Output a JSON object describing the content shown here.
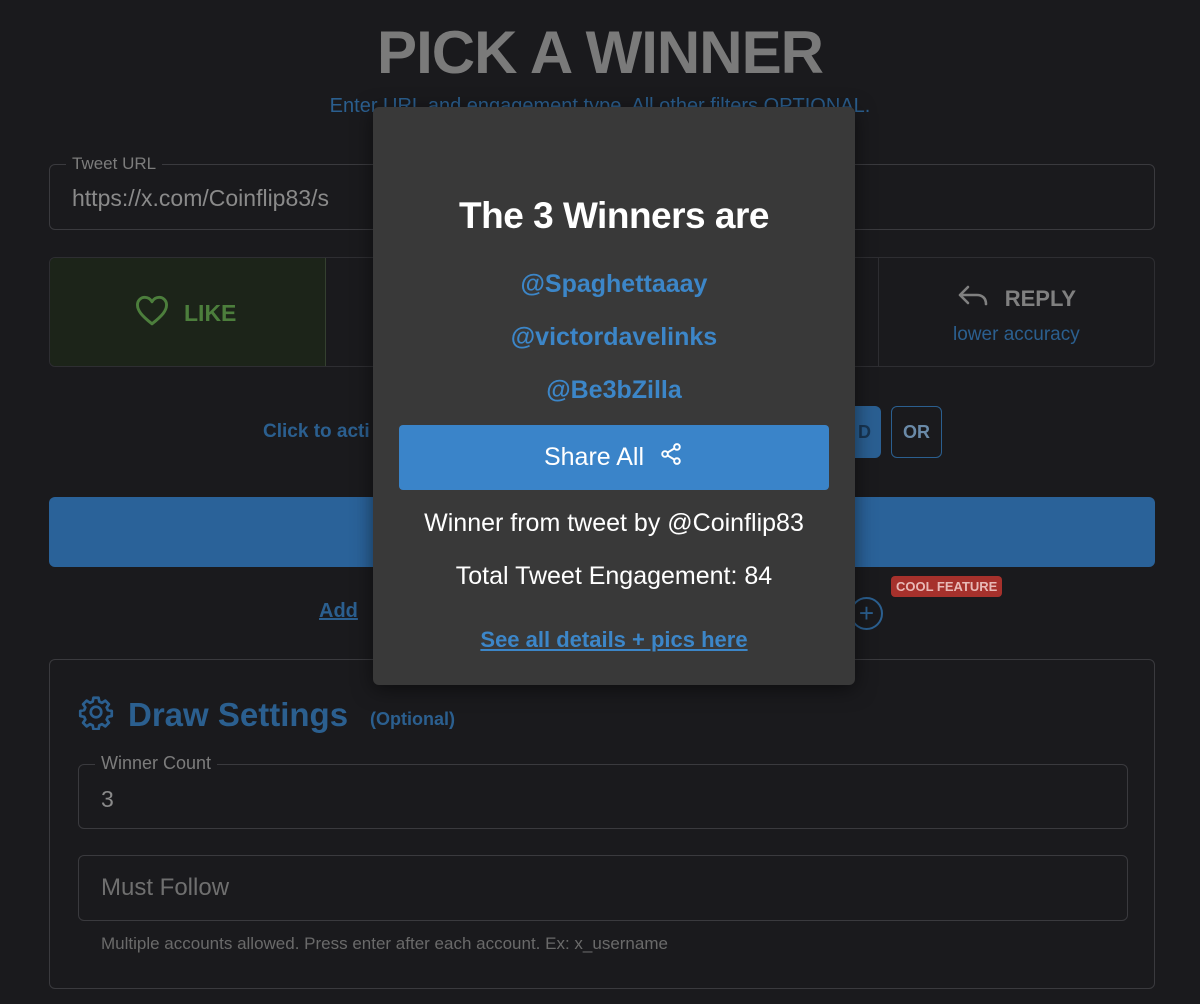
{
  "header": {
    "title": "PICK A WINNER",
    "subtitle": "Enter URL and engagement type. All other filters OPTIONAL."
  },
  "tweet_url": {
    "label": "Tweet URL",
    "value": "https://x.com/Coinflip83/s"
  },
  "engagement": {
    "like_label": "LIKE",
    "reply_label": "REPLY",
    "reply_note": "lower accuracy"
  },
  "mode": {
    "click_text": "Click to acti",
    "and_label": "D",
    "or_label": "OR"
  },
  "add_link": "Add",
  "cool_feature": "COOL FEATURE",
  "settings": {
    "title": "Draw Settings",
    "optional": "(Optional)",
    "winner_count_label": "Winner Count",
    "winner_count_value": "3",
    "must_follow_placeholder": "Must Follow",
    "must_follow_help": "Multiple accounts allowed. Press enter after each account. Ex: x_username"
  },
  "modal": {
    "title": "The 3 Winners are",
    "winners": [
      "@Spaghettaaay",
      "@victordavelinks",
      "@Be3bZilla"
    ],
    "share_label": "Share All",
    "from_text": "Winner from tweet by @Coinflip83",
    "engagement_text": "Total Tweet Engagement: 84",
    "details_link": "See all details + pics here"
  },
  "colors": {
    "accent": "#3a84c9",
    "modal_bg": "#393939",
    "page_bg": "#1a1a1d",
    "badge": "#a6312c"
  }
}
